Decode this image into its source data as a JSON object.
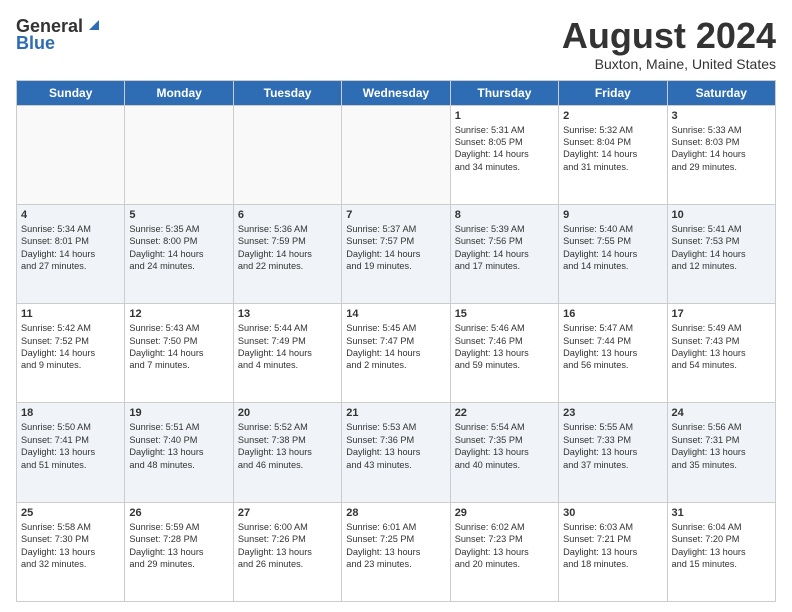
{
  "header": {
    "logo_general": "General",
    "logo_blue": "Blue",
    "month_year": "August 2024",
    "location": "Buxton, Maine, United States"
  },
  "days_of_week": [
    "Sunday",
    "Monday",
    "Tuesday",
    "Wednesday",
    "Thursday",
    "Friday",
    "Saturday"
  ],
  "weeks": [
    [
      {
        "day": "",
        "content": ""
      },
      {
        "day": "",
        "content": ""
      },
      {
        "day": "",
        "content": ""
      },
      {
        "day": "",
        "content": ""
      },
      {
        "day": "1",
        "content": "Sunrise: 5:31 AM\nSunset: 8:05 PM\nDaylight: 14 hours\nand 34 minutes."
      },
      {
        "day": "2",
        "content": "Sunrise: 5:32 AM\nSunset: 8:04 PM\nDaylight: 14 hours\nand 31 minutes."
      },
      {
        "day": "3",
        "content": "Sunrise: 5:33 AM\nSunset: 8:03 PM\nDaylight: 14 hours\nand 29 minutes."
      }
    ],
    [
      {
        "day": "4",
        "content": "Sunrise: 5:34 AM\nSunset: 8:01 PM\nDaylight: 14 hours\nand 27 minutes."
      },
      {
        "day": "5",
        "content": "Sunrise: 5:35 AM\nSunset: 8:00 PM\nDaylight: 14 hours\nand 24 minutes."
      },
      {
        "day": "6",
        "content": "Sunrise: 5:36 AM\nSunset: 7:59 PM\nDaylight: 14 hours\nand 22 minutes."
      },
      {
        "day": "7",
        "content": "Sunrise: 5:37 AM\nSunset: 7:57 PM\nDaylight: 14 hours\nand 19 minutes."
      },
      {
        "day": "8",
        "content": "Sunrise: 5:39 AM\nSunset: 7:56 PM\nDaylight: 14 hours\nand 17 minutes."
      },
      {
        "day": "9",
        "content": "Sunrise: 5:40 AM\nSunset: 7:55 PM\nDaylight: 14 hours\nand 14 minutes."
      },
      {
        "day": "10",
        "content": "Sunrise: 5:41 AM\nSunset: 7:53 PM\nDaylight: 14 hours\nand 12 minutes."
      }
    ],
    [
      {
        "day": "11",
        "content": "Sunrise: 5:42 AM\nSunset: 7:52 PM\nDaylight: 14 hours\nand 9 minutes."
      },
      {
        "day": "12",
        "content": "Sunrise: 5:43 AM\nSunset: 7:50 PM\nDaylight: 14 hours\nand 7 minutes."
      },
      {
        "day": "13",
        "content": "Sunrise: 5:44 AM\nSunset: 7:49 PM\nDaylight: 14 hours\nand 4 minutes."
      },
      {
        "day": "14",
        "content": "Sunrise: 5:45 AM\nSunset: 7:47 PM\nDaylight: 14 hours\nand 2 minutes."
      },
      {
        "day": "15",
        "content": "Sunrise: 5:46 AM\nSunset: 7:46 PM\nDaylight: 13 hours\nand 59 minutes."
      },
      {
        "day": "16",
        "content": "Sunrise: 5:47 AM\nSunset: 7:44 PM\nDaylight: 13 hours\nand 56 minutes."
      },
      {
        "day": "17",
        "content": "Sunrise: 5:49 AM\nSunset: 7:43 PM\nDaylight: 13 hours\nand 54 minutes."
      }
    ],
    [
      {
        "day": "18",
        "content": "Sunrise: 5:50 AM\nSunset: 7:41 PM\nDaylight: 13 hours\nand 51 minutes."
      },
      {
        "day": "19",
        "content": "Sunrise: 5:51 AM\nSunset: 7:40 PM\nDaylight: 13 hours\nand 48 minutes."
      },
      {
        "day": "20",
        "content": "Sunrise: 5:52 AM\nSunset: 7:38 PM\nDaylight: 13 hours\nand 46 minutes."
      },
      {
        "day": "21",
        "content": "Sunrise: 5:53 AM\nSunset: 7:36 PM\nDaylight: 13 hours\nand 43 minutes."
      },
      {
        "day": "22",
        "content": "Sunrise: 5:54 AM\nSunset: 7:35 PM\nDaylight: 13 hours\nand 40 minutes."
      },
      {
        "day": "23",
        "content": "Sunrise: 5:55 AM\nSunset: 7:33 PM\nDaylight: 13 hours\nand 37 minutes."
      },
      {
        "day": "24",
        "content": "Sunrise: 5:56 AM\nSunset: 7:31 PM\nDaylight: 13 hours\nand 35 minutes."
      }
    ],
    [
      {
        "day": "25",
        "content": "Sunrise: 5:58 AM\nSunset: 7:30 PM\nDaylight: 13 hours\nand 32 minutes."
      },
      {
        "day": "26",
        "content": "Sunrise: 5:59 AM\nSunset: 7:28 PM\nDaylight: 13 hours\nand 29 minutes."
      },
      {
        "day": "27",
        "content": "Sunrise: 6:00 AM\nSunset: 7:26 PM\nDaylight: 13 hours\nand 26 minutes."
      },
      {
        "day": "28",
        "content": "Sunrise: 6:01 AM\nSunset: 7:25 PM\nDaylight: 13 hours\nand 23 minutes."
      },
      {
        "day": "29",
        "content": "Sunrise: 6:02 AM\nSunset: 7:23 PM\nDaylight: 13 hours\nand 20 minutes."
      },
      {
        "day": "30",
        "content": "Sunrise: 6:03 AM\nSunset: 7:21 PM\nDaylight: 13 hours\nand 18 minutes."
      },
      {
        "day": "31",
        "content": "Sunrise: 6:04 AM\nSunset: 7:20 PM\nDaylight: 13 hours\nand 15 minutes."
      }
    ]
  ]
}
